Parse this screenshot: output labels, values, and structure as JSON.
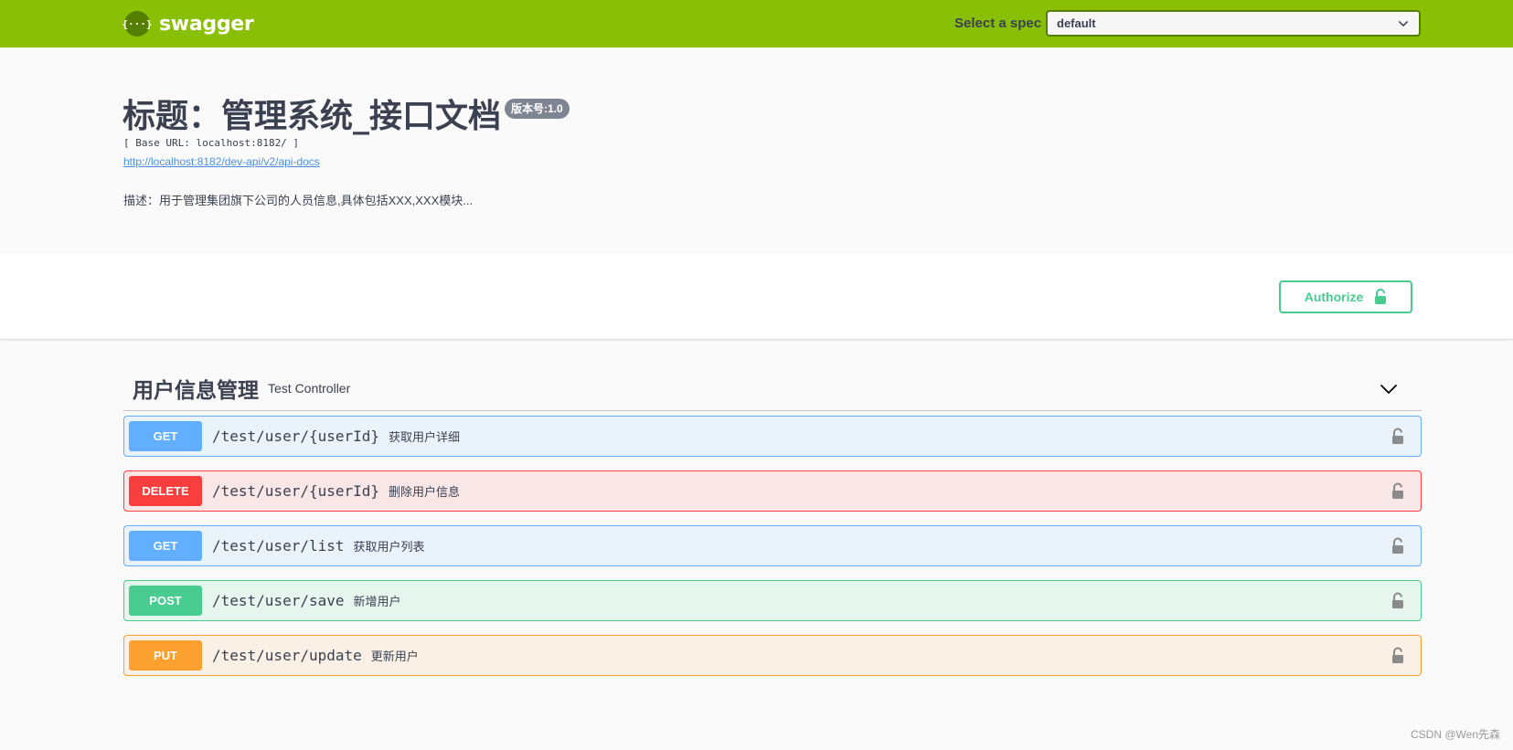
{
  "topbar": {
    "brand_logo_text": "{···}",
    "brand_name": "swagger",
    "spec_label": "Select a spec",
    "spec_selected": "default",
    "color": "#89bf04"
  },
  "info": {
    "title": "标题：管理系统_接口文档",
    "version": "版本号:1.0",
    "base_url": "[ Base URL: localhost:8182/ ]",
    "api_docs_link": "http://localhost:8182/dev-api/v2/api-docs",
    "description": "描述：用于管理集团旗下公司的人员信息,具体包括XXX,XXX模块..."
  },
  "scheme": {
    "authorize_label": "Authorize"
  },
  "tag": {
    "name": "用户信息管理",
    "description": "Test Controller"
  },
  "operations": [
    {
      "method": "GET",
      "path": "/test/user/{userId}",
      "summary": "获取用户详细"
    },
    {
      "method": "DELETE",
      "path": "/test/user/{userId}",
      "summary": "删除用户信息"
    },
    {
      "method": "GET",
      "path": "/test/user/list",
      "summary": "获取用户列表"
    },
    {
      "method": "POST",
      "path": "/test/user/save",
      "summary": "新增用户"
    },
    {
      "method": "PUT",
      "path": "/test/user/update",
      "summary": "更新用户"
    }
  ],
  "method_colors": {
    "GET": "#61affe",
    "DELETE": "#f93e3e",
    "POST": "#49cc90",
    "PUT": "#fca130"
  },
  "watermark": "CSDN @Wen先森"
}
